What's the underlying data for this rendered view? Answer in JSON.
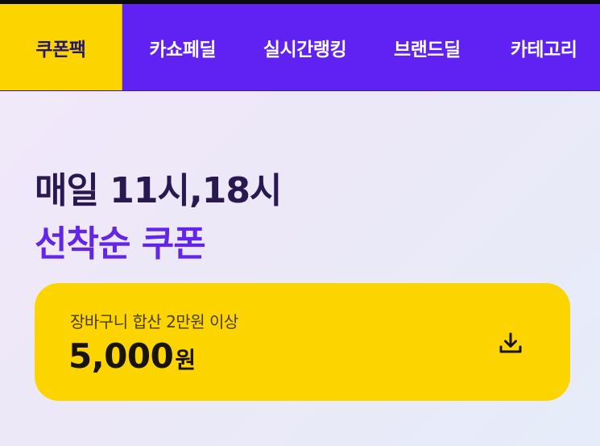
{
  "nav": {
    "tabs": [
      {
        "label": "쿠폰팩",
        "active": true
      },
      {
        "label": "카쇼페딜",
        "active": false
      },
      {
        "label": "실시간랭킹",
        "active": false
      },
      {
        "label": "브랜드딜",
        "active": false
      },
      {
        "label": "카테고리",
        "active": false
      }
    ]
  },
  "headline": {
    "line1": "매일 11시,18시",
    "line2": "선착순 쿠폰"
  },
  "coupon": {
    "condition": "장바구니 합산 2만원 이상",
    "amount": "5,000",
    "unit": "원",
    "action_icon": "download-icon"
  },
  "colors": {
    "nav_background": "#5f22f2",
    "active_tab": "#fcd500",
    "coupon_background": "#fcd500",
    "headline_dark": "#2a1950",
    "headline_accent": "#6325e6"
  }
}
